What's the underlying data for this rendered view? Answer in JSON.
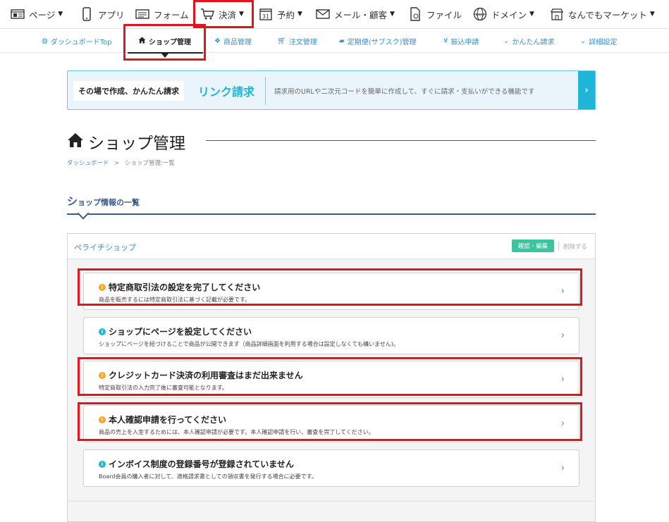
{
  "top_nav": [
    {
      "label": "ページ",
      "icon": "page-icon"
    },
    {
      "label": "アプリ",
      "icon": "phone-icon"
    },
    {
      "label": "フォーム",
      "icon": "form-icon"
    },
    {
      "label": "決済",
      "icon": "cart-icon"
    },
    {
      "label": "予約",
      "icon": "calendar-icon",
      "badge": "31"
    },
    {
      "label": "メール・顧客",
      "icon": "mail-icon"
    },
    {
      "label": "ファイル",
      "icon": "file-icon"
    },
    {
      "label": "ドメイン",
      "icon": "globe-icon",
      "badge": "www"
    },
    {
      "label": "なんでもマーケット",
      "icon": "market-icon"
    }
  ],
  "sub_nav": [
    {
      "label": "ダッシュボードTop",
      "icon": "dashboard-icon"
    },
    {
      "label": "ショップ管理",
      "icon": "home-icon"
    },
    {
      "label": "商品管理",
      "icon": "products-icon"
    },
    {
      "label": "注文管理",
      "icon": "cart-icon"
    },
    {
      "label": "定期便(サブスク)管理",
      "icon": "truck-icon"
    },
    {
      "label": "振込申請",
      "icon": "yen-icon",
      "glyph": "¥"
    },
    {
      "label": "かんたん請求",
      "icon": "chevron-down-icon"
    },
    {
      "label": "詳細設定",
      "icon": "chevron-down-icon"
    }
  ],
  "banner": {
    "label": "その場で作成、かんたん請求",
    "link": "リンク請求",
    "description": "請求用のURLや二次元コードを簡単に作成して、すぐに請求・支払いができる機能です"
  },
  "page_title": "ショップ管理",
  "breadcrumb": {
    "first": "ダッシュボード",
    "sep": ">",
    "current": "ショップ管理:一覧"
  },
  "section": {
    "title_big": "シ",
    "title_rest": "ョップ情報の一覧"
  },
  "panel": {
    "shop_name": "ペライチショップ",
    "edit_button": "確認・編集",
    "delete_link": "削除する"
  },
  "cards": [
    {
      "level": "warn",
      "title": "特定商取引法の設定を完了してください",
      "sub": "商品を販売するには特定商取引法に基づく記載が必要です。"
    },
    {
      "level": "info",
      "title": "ショップにページを設定してください",
      "sub": "ショップにページを紐づけることで商品が公開できます（商品詳細画面を利用する場合は設定しなくても構いません)。"
    },
    {
      "level": "warn",
      "title": "クレジットカード決済の利用審査はまだ出来ません",
      "sub": "特定商取引法の入力完了後に審査可能となります。"
    },
    {
      "level": "warn",
      "title": "本人確認申請を行ってください",
      "sub": "商品の売上を入金するためには、本人確認申請が必要です。本人確認申請を行い、審査を完了してください。"
    },
    {
      "level": "info",
      "title": "インボイス制度の登録番号が登録されていません",
      "sub": "Board会員の購入者に対して、適格請求書としての領収書を発行する場合に必要です。"
    }
  ],
  "colors": {
    "highlight": "#e0161e",
    "accent": "#1fb6d8",
    "link": "#3a8fc7",
    "warn": "#f5a623",
    "edit": "#3cc3a0"
  }
}
